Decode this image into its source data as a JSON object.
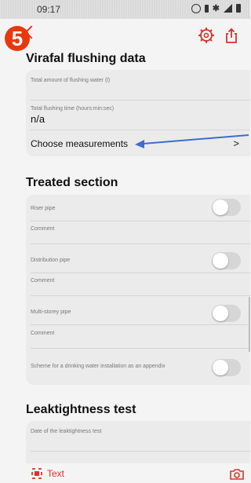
{
  "status_bar": {
    "time": "09:17"
  },
  "annotation": {
    "step_number": "5"
  },
  "flushing": {
    "title": "Virafal flushing data",
    "total_water_label": "Total amount of flushing water (l)",
    "total_time_label": "Total flushing time (hours:min:sec)",
    "total_time_value": "n/a",
    "choose_label": "Choose measurements",
    "chevron": ">"
  },
  "treated": {
    "title": "Treated section",
    "riser_label": "Riser pipe",
    "riser_on": false,
    "riser_comment": "Comment",
    "distribution_label": "Distribution pipe",
    "distribution_on": false,
    "distribution_comment": "Comment",
    "multistorey_label": "Multi-storey pipe",
    "multistorey_on": false,
    "multistorey_comment": "Comment",
    "scheme_label": "Scheme for a drinking water installation as an appendix",
    "scheme_on": false
  },
  "leak": {
    "title": "Leaktightness test",
    "date_label": "Date of the leaktightness test"
  },
  "bottom": {
    "text_label": "Text"
  },
  "icons": {
    "settings": "gear-icon",
    "share": "share-icon",
    "back": "chevron-left-icon",
    "camera": "camera-icon",
    "text_scan": "text-scan-icon"
  },
  "colors": {
    "accent": "#d9342b",
    "badge": "#e8390e",
    "annotation_arrow": "#3d6fc7",
    "card": "#ebebeb",
    "background": "#f4f4f4"
  }
}
